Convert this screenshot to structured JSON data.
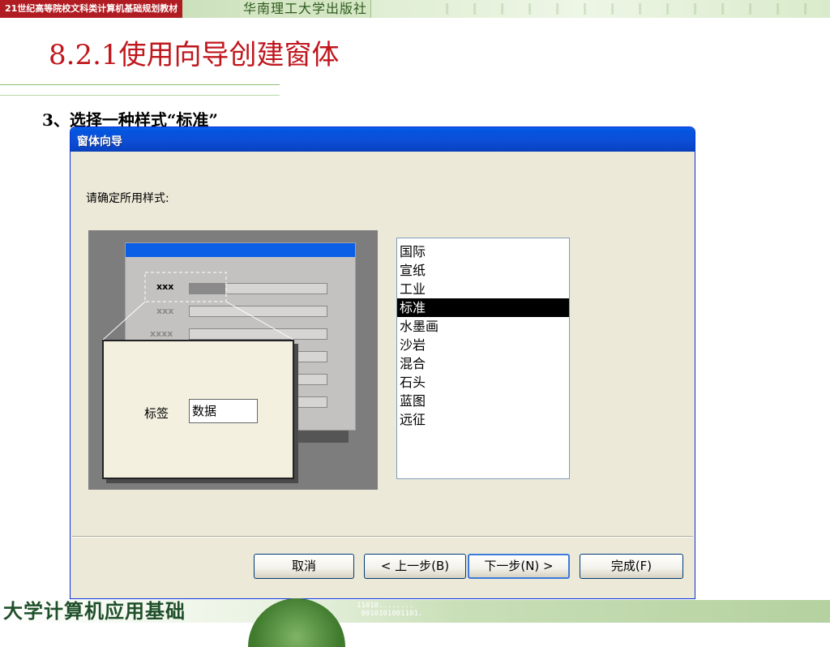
{
  "slide": {
    "series_label": "21世纪高等院校文科类计算机基础规划教材",
    "publisher": "华南理工大学出版社",
    "title": "8.2.1使用向导创建窗体",
    "step_text": "3、选择一种样式“标准”",
    "footer_title": "大学计算机应用基础",
    "footer_binary": "11010........\n 0010101001101."
  },
  "dialog": {
    "title": "窗体向导",
    "prompt": "请确定所用样式:",
    "preview": {
      "mini_labels": [
        "xxx",
        "xxx",
        "xxxx"
      ],
      "callout_label": "标签",
      "callout_field": "数据"
    },
    "styles": [
      "国际",
      "宣纸",
      "工业",
      "标准",
      "水墨画",
      "沙岩",
      "混合",
      "石头",
      "蓝图",
      "远征"
    ],
    "selected_style": "标准",
    "buttons": {
      "cancel": "取消",
      "back": "< 上一步(B)",
      "next": "下一步(N) >",
      "finish": "完成(F)"
    }
  },
  "colors": {
    "title_red": "#c0161d",
    "titlebar_blue": "#0a5fe6",
    "dialog_bg": "#ece9d8",
    "selection": "#000000"
  }
}
